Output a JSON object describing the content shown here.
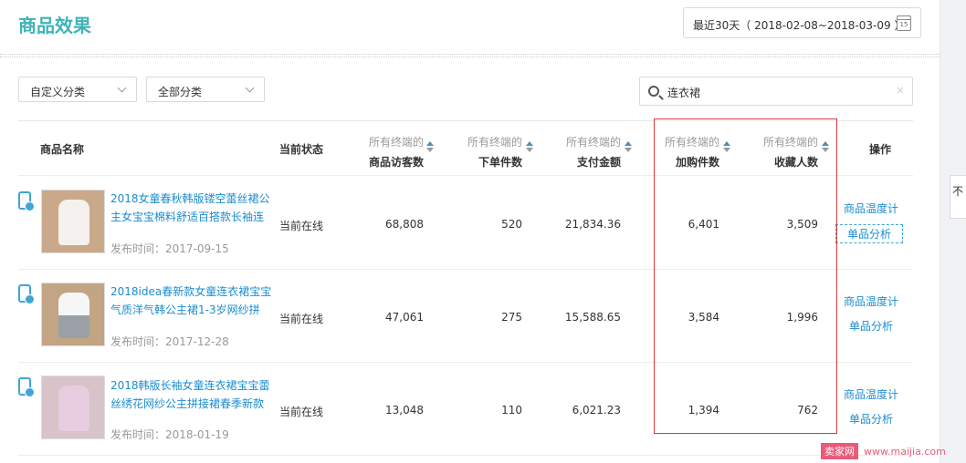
{
  "header": {
    "title": "商品效果",
    "date_range": "最近30天（ 2018-02-08~2018-03-09 ）",
    "calendar_icon": "calendar-icon",
    "calendar_day": "15"
  },
  "filters": {
    "custom_category": "自定义分类",
    "all_category": "全部分类",
    "search_value": "连衣裙",
    "clear_symbol": "×"
  },
  "table": {
    "headers": {
      "name": "商品名称",
      "status": "当前状态",
      "visitors": {
        "sub": "所有终端的",
        "main": "商品访客数"
      },
      "orders": {
        "sub": "所有终端的",
        "main": "下单件数"
      },
      "payment": {
        "sub": "所有终端的",
        "main": "支付金额"
      },
      "cart": {
        "sub": "所有终端的",
        "main": "加购件数"
      },
      "favorites": {
        "sub": "所有终端的",
        "main": "收藏人数"
      },
      "actions": "操作"
    },
    "rows": [
      {
        "title": "2018女童春秋韩版镂空蕾丝裙公主女宝宝棉料舒适百搭款长袖连",
        "published": "发布时间：2017-09-15",
        "status": "当前在线",
        "visitors": "68,808",
        "orders": "520",
        "payment": "21,834.36",
        "cart": "6,401",
        "favorites": "3,509",
        "action_temp": "商品温度计",
        "action_analysis": "单品分析"
      },
      {
        "title": "2018idea春新款女童连衣裙宝宝气质洋气韩公主裙1-3岁网纱拼",
        "published": "发布时间：2017-12-28",
        "status": "当前在线",
        "visitors": "47,061",
        "orders": "275",
        "payment": "15,588.65",
        "cart": "3,584",
        "favorites": "1,996",
        "action_temp": "商品温度计",
        "action_analysis": "单品分析"
      },
      {
        "title": "2018韩版长袖女童连衣裙宝宝蕾丝绣花网纱公主拼接裙春季新款",
        "published": "发布时间：2018-01-19",
        "status": "当前在线",
        "visitors": "13,048",
        "orders": "110",
        "payment": "6,021.23",
        "cart": "1,394",
        "favorites": "762",
        "action_temp": "商品温度计",
        "action_analysis": "单品分析"
      }
    ]
  },
  "side_tab": "不",
  "watermark": {
    "badge": "卖家网",
    "url": "www.maijia.com"
  },
  "colors": {
    "accent": "#3fb3b8",
    "link": "#1b8ccf",
    "highlight": "#d9383a",
    "watermark": "#e85b79"
  }
}
